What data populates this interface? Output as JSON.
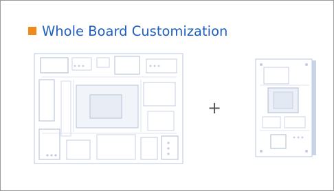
{
  "card": {
    "title": "Whole Board Customization",
    "marker_color": "#f08a1c",
    "title_color": "#1f5fbf"
  },
  "images": {
    "left": "carrier-board-image",
    "operator": "+",
    "right": "core-module-image"
  }
}
